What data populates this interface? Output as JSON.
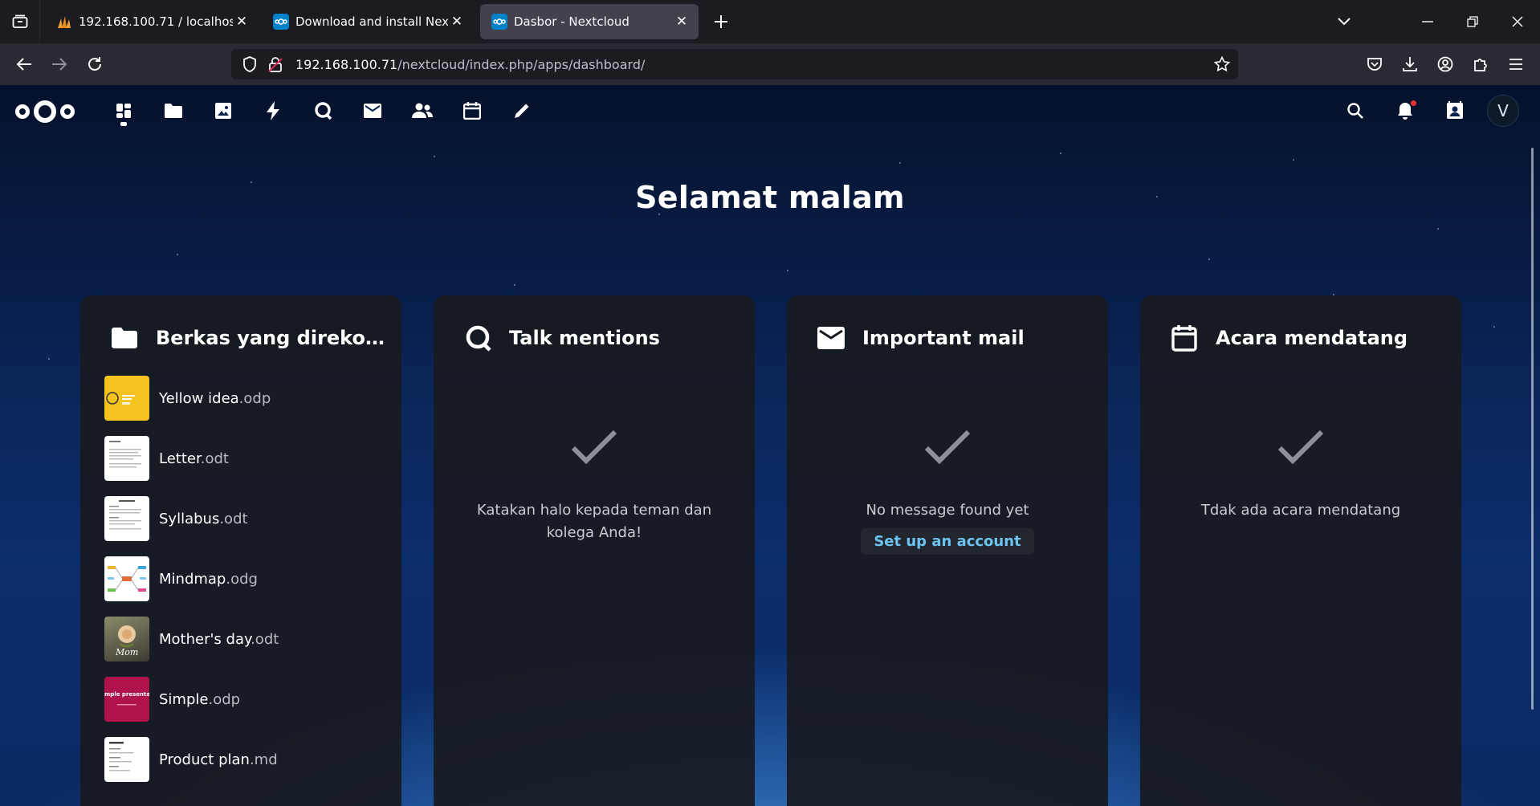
{
  "browser": {
    "tabs": [
      {
        "title": "192.168.100.71 / localhost / db_",
        "favicon": "phpmyadmin-icon",
        "active": false
      },
      {
        "title": "Download and install Nextclou",
        "favicon": "nextcloud-icon",
        "active": false
      },
      {
        "title": "Dasbor - Nextcloud",
        "favicon": "nextcloud-icon",
        "active": true
      }
    ],
    "url_host": "192.168.100.71",
    "url_path": "/nextcloud/index.php/apps/dashboard/"
  },
  "nextcloud": {
    "header_apps": [
      "dashboard-icon",
      "files-icon",
      "photos-icon",
      "activity-icon",
      "talk-icon",
      "mail-icon",
      "contacts-icon",
      "calendar-icon",
      "notes-icon"
    ],
    "avatar_letter": "V",
    "greeting": "Selamat malam",
    "panels": {
      "files": {
        "title": "Berkas yang direkom…",
        "items": [
          {
            "name": "Yellow idea",
            "ext": ".odp"
          },
          {
            "name": "Letter",
            "ext": ".odt"
          },
          {
            "name": "Syllabus",
            "ext": ".odt"
          },
          {
            "name": "Mindmap",
            "ext": ".odg"
          },
          {
            "name": "Mother's day",
            "ext": ".odt"
          },
          {
            "name": "Simple",
            "ext": ".odp"
          },
          {
            "name": "Product plan",
            "ext": ".md"
          }
        ]
      },
      "talk": {
        "title": "Talk mentions",
        "empty_message": "Katakan halo kepada teman dan kolega Anda!"
      },
      "mail": {
        "title": "Important mail",
        "empty_message": "No message found yet",
        "action": "Set up an account"
      },
      "calendar": {
        "title": "Acara mendatang",
        "empty_message": "Tdak ada acara mendatang"
      }
    },
    "thumb_labels": {
      "mom": "Mom",
      "simple": "mple presentati"
    }
  }
}
